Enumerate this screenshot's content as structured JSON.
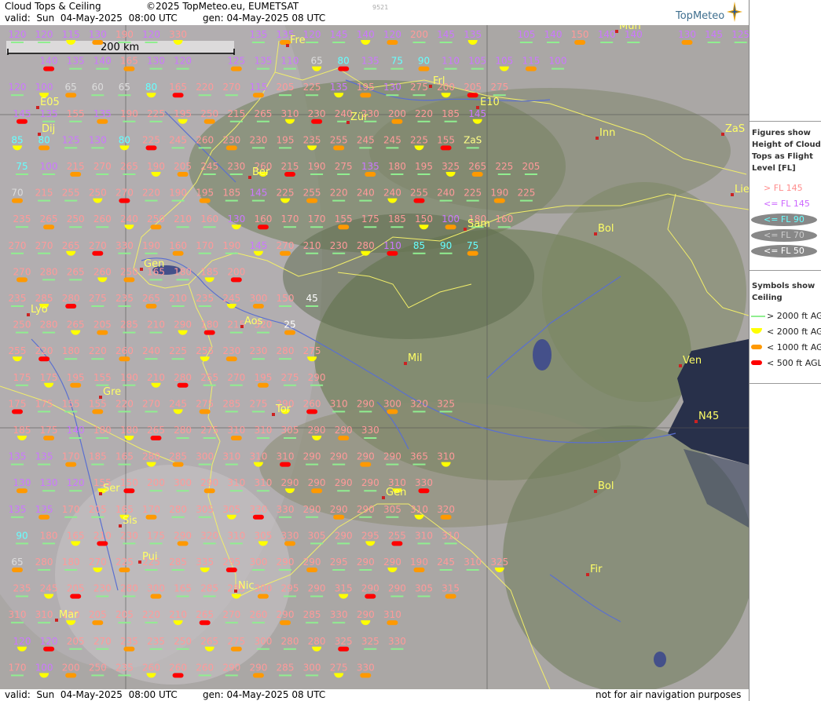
{
  "header": {
    "title": "Cloud Tops & Ceiling",
    "copyright": "©2025 TopMeteo.eu, EUMETSAT",
    "valid": "valid:  Sun  04-May-2025  08:00 UTC",
    "gen": "gen: 04-May-2025 08 UTC",
    "code": "9521",
    "logo": "TopMeteo"
  },
  "footer": {
    "valid": "valid:  Sun  04-May-2025  08:00 UTC",
    "gen": "gen: 04-May-2025 08 UTC",
    "disclaimer": "not for air navigation purposes"
  },
  "scale_label": "200 km",
  "legend": {
    "figures_title": "Figures show Height of Cloud Tops as Flight Level  [FL]",
    "fl_items": [
      {
        "label": "> FL 145",
        "color": "#ff8c8c"
      },
      {
        "label": "<= FL 145",
        "color": "#cc66ff"
      },
      {
        "label": "<= FL 90",
        "color": "#66ffff"
      },
      {
        "label": "<= FL 70",
        "color": "#cccccc"
      },
      {
        "label": "<= FL 50",
        "color": "#ffffff"
      }
    ],
    "symbols_title": "Symbols show Ceiling",
    "ceiling_items": [
      {
        "label": "> 2000 ft AGL",
        "color": "#90ee90"
      },
      {
        "label": "< 2000 ft AGL",
        "color": "#ffff00"
      },
      {
        "label": "< 1000 ft AGL",
        "color": "#ff9900"
      },
      {
        "label": "< 500 ft AGL",
        "color": "#ff0000"
      }
    ]
  },
  "cities": [
    "Mun",
    "Fre",
    "Dij",
    "Zür",
    "Inn",
    "ZaS",
    "Lie",
    "Ber",
    "Sam",
    "Bol",
    "Gen",
    "Lyo",
    "Aos",
    "Mil",
    "Ven",
    "Gre",
    "Tor",
    "N45",
    "Ser",
    "Gen",
    "Bol",
    "Sis",
    "Pui",
    "Nic",
    "Fir",
    "Mar",
    "E05",
    "E10",
    "Frl"
  ],
  "fl_rows": [
    [
      "120",
      "120",
      "115",
      "130",
      "190",
      "120",
      "330",
      "",
      "",
      "135",
      "135",
      "120",
      "145",
      "140",
      "120",
      "200",
      "145",
      "135",
      "",
      "105",
      "140",
      "150",
      "140",
      "140",
      "",
      "130",
      "145",
      "125",
      "145",
      "125",
      "125"
    ],
    [
      "",
      "140",
      "135",
      "140",
      "165",
      "130",
      "120",
      "",
      "125",
      "135",
      "110",
      "65",
      "80",
      "135",
      "75",
      "90",
      "110",
      "105",
      "105",
      "115",
      "100"
    ],
    [
      "120",
      "100",
      "65",
      "60",
      "65",
      "80",
      "165",
      "220",
      "270",
      "115",
      "205",
      "225",
      "135",
      "195",
      "130",
      "275",
      "200",
      "205",
      "275"
    ],
    [
      "145",
      "135",
      "155",
      "135",
      "190",
      "225",
      "195",
      "250",
      "215",
      "265",
      "310",
      "230",
      "240",
      "230",
      "200",
      "220",
      "185",
      "145"
    ],
    [
      "85",
      "80",
      "125",
      "130",
      "80",
      "225",
      "245",
      "260",
      "230",
      "230",
      "195",
      "235",
      "255",
      "245",
      "245",
      "225",
      "155",
      "ZaS"
    ],
    [
      "75",
      "100",
      "215",
      "270",
      "265",
      "190",
      "205",
      "245",
      "230",
      "260",
      "215",
      "190",
      "275",
      "135",
      "180",
      "195",
      "325",
      "265",
      "225",
      "205"
    ],
    [
      "70",
      "215",
      "255",
      "250",
      "270",
      "220",
      "190",
      "195",
      "185",
      "145",
      "225",
      "255",
      "220",
      "240",
      "240",
      "255",
      "240",
      "225",
      "190",
      "225"
    ],
    [
      "235",
      "265",
      "250",
      "260",
      "240",
      "250",
      "210",
      "160",
      "130",
      "160",
      "170",
      "170",
      "155",
      "175",
      "185",
      "150",
      "100",
      "180",
      "160"
    ],
    [
      "270",
      "270",
      "265",
      "270",
      "330",
      "190",
      "160",
      "170",
      "190",
      "145",
      "270",
      "210",
      "230",
      "280",
      "110",
      "85",
      "90",
      "75"
    ],
    [
      "270",
      "280",
      "265",
      "260",
      "250",
      "165",
      "180",
      "185",
      "200"
    ],
    [
      "235",
      "285",
      "280",
      "275",
      "235",
      "265",
      "210",
      "235",
      "245",
      "300",
      "150",
      "45"
    ],
    [
      "250",
      "280",
      "265",
      "205",
      "285",
      "210",
      "290",
      "180",
      "215",
      "320",
      "25"
    ],
    [
      "255",
      "220",
      "180",
      "220",
      "260",
      "240",
      "225",
      "255",
      "230",
      "230",
      "280",
      "275"
    ],
    [
      "175",
      "175",
      "195",
      "155",
      "190",
      "210",
      "280",
      "255",
      "270",
      "195",
      "275",
      "290"
    ],
    [
      "175",
      "175",
      "155",
      "155",
      "220",
      "270",
      "245",
      "275",
      "285",
      "275",
      "290",
      "260",
      "310",
      "290",
      "300",
      "320",
      "325"
    ],
    [
      "185",
      "175",
      "140",
      "180",
      "180",
      "265",
      "280",
      "275",
      "310",
      "310",
      "305",
      "290",
      "290",
      "330"
    ],
    [
      "135",
      "135",
      "170",
      "185",
      "165",
      "280",
      "285",
      "300",
      "310",
      "310",
      "310",
      "290",
      "290",
      "290",
      "290",
      "365",
      "310"
    ],
    [
      "130",
      "130",
      "120",
      "155",
      "150",
      "200",
      "300",
      "290",
      "310",
      "310",
      "290",
      "290",
      "290",
      "290",
      "310",
      "330"
    ],
    [
      "135",
      "135",
      "170",
      "205",
      "165",
      "170",
      "280",
      "305",
      "305",
      "330",
      "330",
      "290",
      "290",
      "290",
      "305",
      "310",
      "320"
    ],
    [
      "90",
      "180",
      "165",
      "210",
      "230",
      "175",
      "290",
      "320",
      "310",
      "305",
      "330",
      "305",
      "290",
      "295",
      "255",
      "310",
      "310"
    ],
    [
      "65",
      "280",
      "180",
      "270",
      "225",
      "225",
      "285",
      "335",
      "295",
      "300",
      "290",
      "290",
      "295",
      "290",
      "290",
      "190",
      "245",
      "310",
      "325"
    ],
    [
      "235",
      "245",
      "205",
      "230",
      "280",
      "300",
      "165",
      "285",
      "285",
      "300",
      "295",
      "290",
      "315",
      "290",
      "290",
      "305",
      "315"
    ],
    [
      "310",
      "310",
      "190",
      "205",
      "205",
      "220",
      "210",
      "265",
      "270",
      "260",
      "290",
      "285",
      "330",
      "290",
      "310"
    ],
    [
      "120",
      "120",
      "205",
      "270",
      "235",
      "235",
      "250",
      "265",
      "275",
      "300",
      "280",
      "280",
      "325",
      "325",
      "330"
    ],
    [
      "170",
      "100",
      "200",
      "250",
      "235",
      "260",
      "260",
      "260",
      "290",
      "290",
      "285",
      "300",
      "275",
      "330"
    ]
  ]
}
